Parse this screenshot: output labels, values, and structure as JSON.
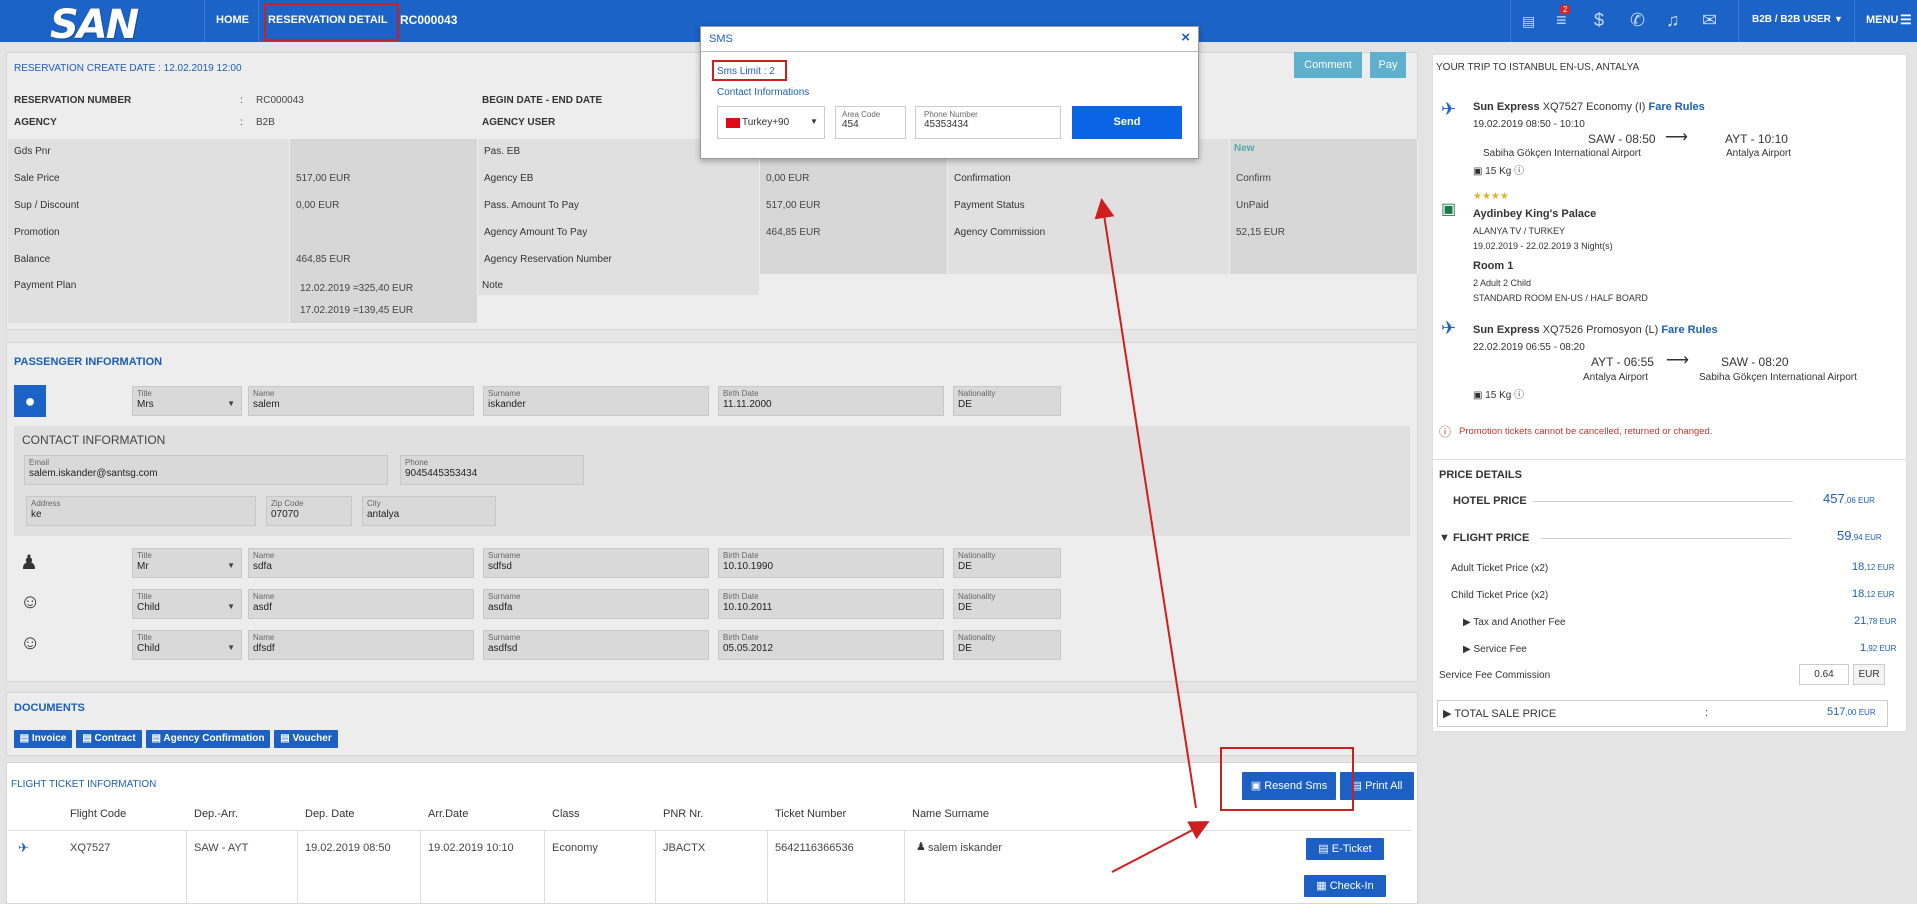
{
  "header": {
    "logo": "SAN",
    "home": "HOME",
    "reservation_detail": "RESERVATION DETAIL",
    "res_code": "RC000043",
    "user": "B2B / B2B USER",
    "menu": "MENU",
    "notification_count": "2"
  },
  "res": {
    "create_date": "RESERVATION CREATE DATE : 12.02.2019 12:00",
    "comment": "Comment",
    "pay": "Pay",
    "num_label": "RESERVATION NUMBER",
    "num_val": "RC000043",
    "agency_label": "AGENCY",
    "agency_val": "B2B",
    "colon": ":",
    "begin_end": "BEGIN DATE - END DATE",
    "agency_user": "AGENCY USER",
    "status_new": "New",
    "rows": [
      {
        "a": "Gds Pnr",
        "b": "",
        "c": "Pas. EB",
        "d": "",
        "e": "",
        "f": ""
      },
      {
        "a": "Sale Price",
        "b": "517,00 EUR",
        "c": "Agency EB",
        "d": "0,00 EUR",
        "e": "Confirmation",
        "f": "Confirm"
      },
      {
        "a": "Sup / Discount",
        "b": "0,00 EUR",
        "c": "Pass. Amount To Pay",
        "d": "517,00 EUR",
        "e": "Payment Status",
        "f": "UnPaid"
      },
      {
        "a": "Promotion",
        "b": "",
        "c": "Agency Amount To Pay",
        "d": "464,85 EUR",
        "e": "Agency Commission",
        "f": "52,15 EUR"
      },
      {
        "a": "Balance",
        "b": "464,85 EUR",
        "c": "Agency Reservation Number",
        "d": "",
        "e": "",
        "f": ""
      }
    ],
    "plan_label": "Payment Plan",
    "note_label": "Note",
    "plan1": "12.02.2019 =325,40 EUR",
    "plan2": "17.02.2019 =139,45 EUR"
  },
  "passengers": {
    "title": "PASSENGER INFORMATION",
    "contact_title": "CONTACT INFORMATION",
    "labels": {
      "title": "Title",
      "name": "Name",
      "surname": "Surname",
      "birth": "Birth Date",
      "nat": "Nationality",
      "email": "Email",
      "phone": "Phone",
      "address": "Address",
      "zip": "Zip Code",
      "city": "City"
    },
    "p1": {
      "title": "Mrs",
      "name": "salem",
      "surname": "iskander",
      "birth": "11.11.2000",
      "nat": "DE"
    },
    "contact": {
      "email": "salem.iskander@santsg.com",
      "phone": "9045445353434",
      "address": "ke",
      "zip": "07070",
      "city": "antalya"
    },
    "p2": {
      "title": "Mr",
      "name": "sdfa",
      "surname": "sdfsd",
      "birth": "10.10.1990",
      "nat": "DE"
    },
    "p3": {
      "title": "Child",
      "name": "asdf",
      "surname": "asdfa",
      "birth": "10.10.2011",
      "nat": "DE"
    },
    "p4": {
      "title": "Child",
      "name": "dfsdf",
      "surname": "asdfsd",
      "birth": "05.05.2012",
      "nat": "DE"
    }
  },
  "documents": {
    "title": "DOCUMENTS",
    "invoice": "Invoice",
    "contract": "Contract",
    "agency_conf": "Agency Confirmation",
    "voucher": "Voucher"
  },
  "flight": {
    "title": "FLIGHT TICKET INFORMATION",
    "resend": "Resend Sms",
    "print_all": "Print All",
    "cols": [
      "Flight Code",
      "Dep.-Arr.",
      "Dep. Date",
      "Arr.Date",
      "Class",
      "PNR Nr.",
      "Ticket Number",
      "Name Surname"
    ],
    "row": [
      "XQ7527",
      "SAW - AYT",
      "19.02.2019 08:50",
      "19.02.2019 10:10",
      "Economy",
      "JBACTX",
      "5642116366536",
      "salem iskander"
    ],
    "eticket": "E-Ticket",
    "checkin": "Check-In"
  },
  "trip": {
    "title": "YOUR TRIP TO ISTANBUL EN-US, ANTALYA",
    "f1": {
      "airline": "Sun Express",
      "code": "XQ7527 Economy (I)",
      "fare": "Fare Rules",
      "date": "19.02.2019 08:50 - 10:10",
      "dep": "SAW - 08:50",
      "arr": "AYT - 10:10",
      "dep_ap": "Sabiha Gökçen International Airport",
      "arr_ap": "Antalya Airport",
      "bag": "15 Kg"
    },
    "hotel": {
      "stars": "★★★★",
      "name": "Aydinbey King's Palace",
      "loc": "ALANYA TV / TURKEY",
      "dates": "19.02.2019 - 22.02.2019 3 Night(s)",
      "room": "Room 1",
      "pax": "2 Adult 2 Child",
      "board": "STANDARD ROOM EN-US / HALF BOARD"
    },
    "f2": {
      "airline": "Sun Express",
      "code": "XQ7526 Promosyon (L)",
      "fare": "Fare Rules",
      "date": "22.02.2019 06:55 - 08:20",
      "dep": "AYT - 06:55",
      "arr": "SAW - 08:20",
      "dep_ap": "Antalya Airport",
      "arr_ap": "Sabiha Gökçen International Airport",
      "bag": "15 Kg"
    },
    "warn": "Promotion tickets cannot be cancelled, returned or changed."
  },
  "price": {
    "title": "PRICE DETAILS",
    "hotel": "HOTEL PRICE",
    "hotel_v": "457",
    "hotel_c": ",06 EUR",
    "flight": "FLIGHT PRICE",
    "flight_v": "59",
    "flight_c": ",94 EUR",
    "adult": "Adult Ticket Price (x2)",
    "adult_v": "18",
    "adult_c": ",12 EUR",
    "child": "Child Ticket Price (x2)",
    "child_v": "18",
    "child_c": ",12 EUR",
    "tax": "Tax and Another Fee",
    "tax_v": "21",
    "tax_c": ",78 EUR",
    "service": "Service Fee",
    "service_v": "1",
    "service_c": ",92 EUR",
    "commission": "Service Fee Commission",
    "commission_v": "0.64",
    "commission_cur": "EUR",
    "total": "TOTAL SALE PRICE",
    "total_colon": ":",
    "total_v": "517",
    "total_c": ",00 EUR"
  },
  "sms": {
    "title": "SMS",
    "close": "×",
    "limit": "Sms Limit : 2",
    "contact": "Contact Informations",
    "country": "Turkey+90",
    "area_label": "Area Code",
    "area": "454",
    "phone_label": "Phone Number",
    "phone": "45353434",
    "send": "Send"
  }
}
